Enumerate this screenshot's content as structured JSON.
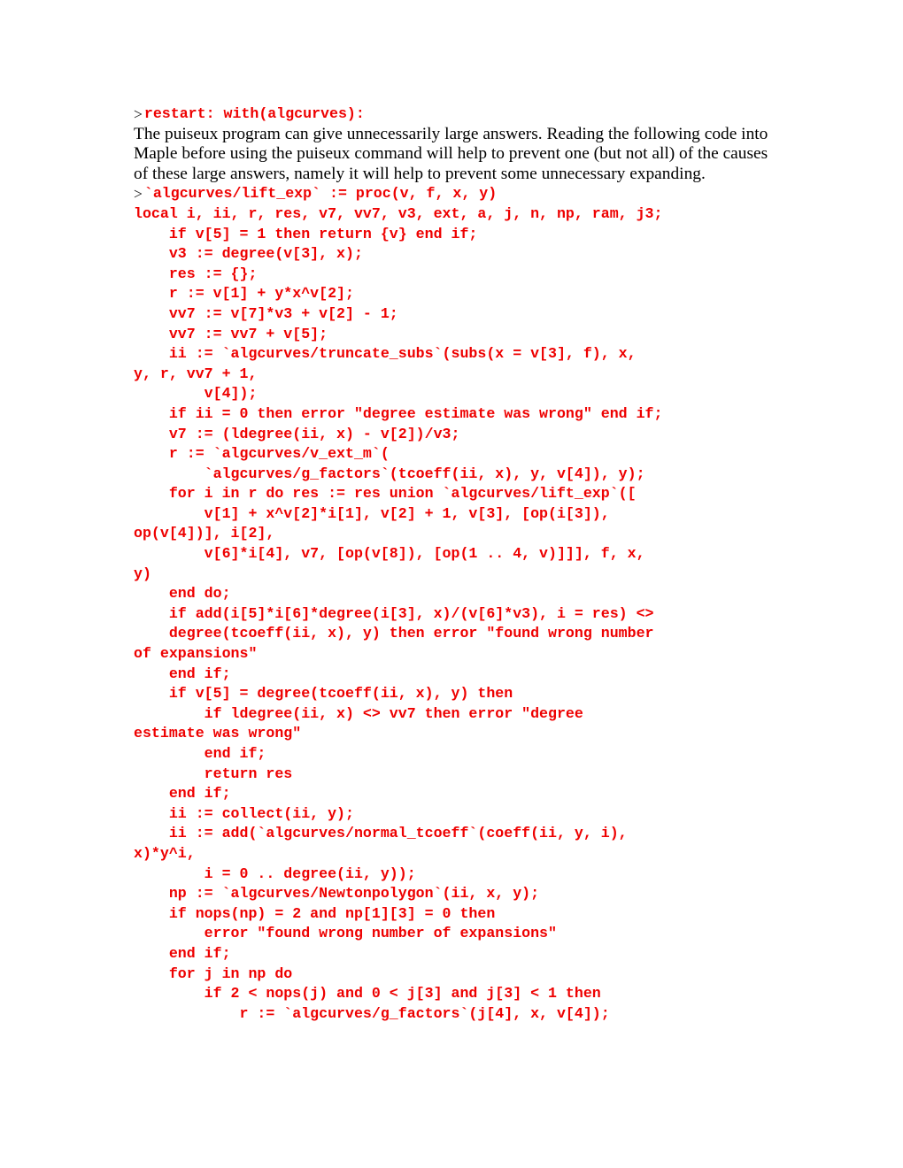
{
  "document": {
    "kind": "maple-worksheet-printout",
    "background_color": "#ffffff",
    "code_color": "#ee0000",
    "text_color": "#000000",
    "prompt_color": "#1a1a1a"
  },
  "prompt_symbol": ">",
  "groups": {
    "restart": {
      "prompt": ">",
      "code": "restart: with(algcurves):"
    },
    "proc_header": {
      "prompt": ">",
      "code": "`algcurves/lift_exp` := proc(v, f, x, y)"
    }
  },
  "paragraph": {
    "text": "The puiseux program can give unnecessarily large answers. Reading the following code into Maple before using the puiseux command will help to prevent one (but not all) of the causes of these large answers, namely it will help to prevent some unnecessary expanding."
  },
  "code_body": {
    "lines": [
      "local i, ii, r, res, v7, vv7, v3, ext, a, j, n, np, ram, j3;",
      "    if v[5] = 1 then return {v} end if;",
      "    v3 := degree(v[3], x);",
      "    res := {};",
      "    r := v[1] + y*x^v[2];",
      "    vv7 := v[7]*v3 + v[2] - 1;",
      "    vv7 := vv7 + v[5];",
      "    ii := `algcurves/truncate_subs`(subs(x = v[3], f), x,",
      "y, r, vv7 + 1,",
      "        v[4]);",
      "    if ii = 0 then error \"degree estimate was wrong\" end if;",
      "    v7 := (ldegree(ii, x) - v[2])/v3;",
      "    r := `algcurves/v_ext_m`(",
      "        `algcurves/g_factors`(tcoeff(ii, x), y, v[4]), y);",
      "    for i in r do res := res union `algcurves/lift_exp`([",
      "        v[1] + x^v[2]*i[1], v[2] + 1, v[3], [op(i[3]),",
      "op(v[4])], i[2],",
      "        v[6]*i[4], v7, [op(v[8]), [op(1 .. 4, v)]]], f, x,",
      "y)",
      "    end do;",
      "    if add(i[5]*i[6]*degree(i[3], x)/(v[6]*v3), i = res) <>",
      "    degree(tcoeff(ii, x), y) then error \"found wrong number",
      "of expansions\"",
      "    end if;",
      "    if v[5] = degree(tcoeff(ii, x), y) then",
      "        if ldegree(ii, x) <> vv7 then error \"degree",
      "estimate was wrong\"",
      "        end if;",
      "        return res",
      "    end if;",
      "    ii := collect(ii, y);",
      "    ii := add(`algcurves/normal_tcoeff`(coeff(ii, y, i),",
      "x)*y^i,",
      "        i = 0 .. degree(ii, y));",
      "    np := `algcurves/Newtonpolygon`(ii, x, y);",
      "    if nops(np) = 2 and np[1][3] = 0 then",
      "        error \"found wrong number of expansions\"",
      "    end if;",
      "    for j in np do",
      "        if 2 < nops(j) and 0 < j[3] and j[3] < 1 then",
      "            r := `algcurves/g_factors`(j[4], x, v[4]);"
    ]
  }
}
